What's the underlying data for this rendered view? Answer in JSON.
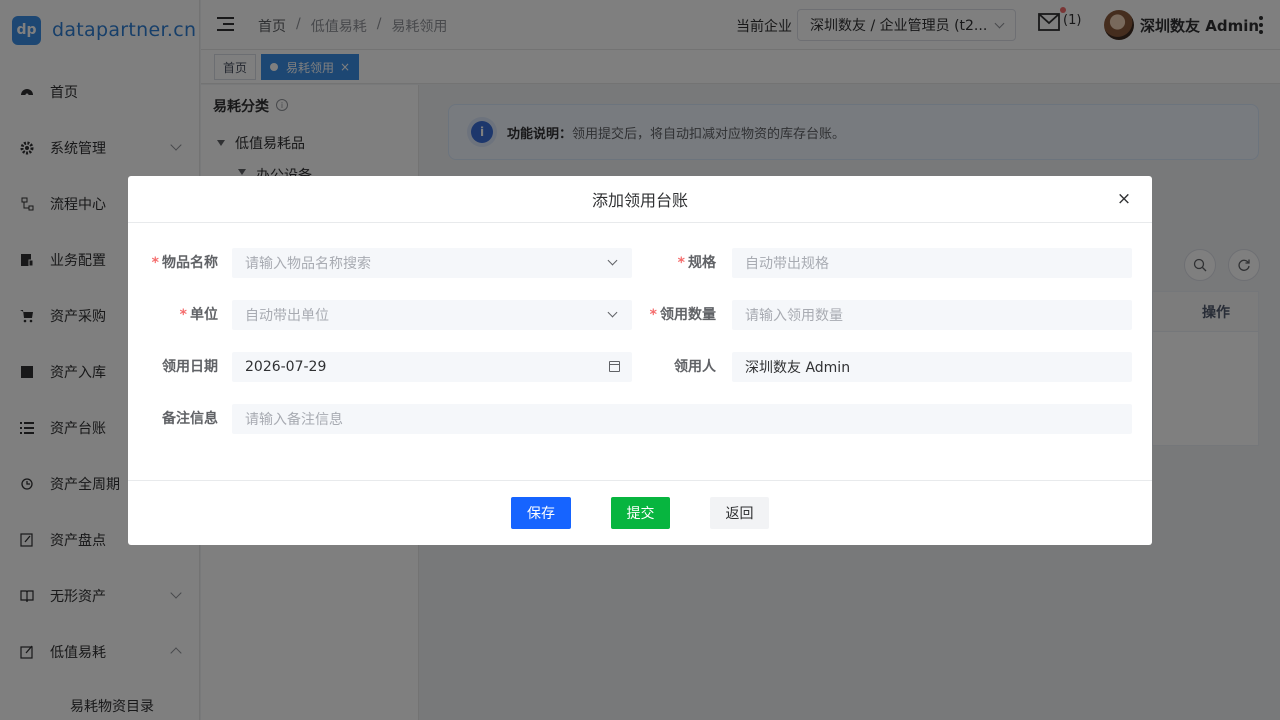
{
  "brand": {
    "badge": "dp",
    "name": "datapartner.cn"
  },
  "sidebar": {
    "items": [
      {
        "label": "首页",
        "icon": "dashboard-icon"
      },
      {
        "label": "系统管理",
        "icon": "gear-icon"
      },
      {
        "label": "流程中心",
        "icon": "flow-icon"
      },
      {
        "label": "业务配置",
        "icon": "config-icon"
      },
      {
        "label": "资产采购",
        "icon": "cart-icon"
      },
      {
        "label": "资产入库",
        "icon": "warehouse-icon"
      },
      {
        "label": "资产台账",
        "icon": "list-icon"
      },
      {
        "label": "资产全周期",
        "icon": "cycle-icon"
      },
      {
        "label": "资产盘点",
        "icon": "edit-icon"
      },
      {
        "label": "无形资产",
        "icon": "book-icon"
      },
      {
        "label": "低值易耗",
        "icon": "note-icon"
      }
    ],
    "sub_item": "易耗物资目录"
  },
  "header": {
    "breadcrumb": [
      "首页",
      "低值易耗",
      "易耗领用"
    ],
    "company_label": "当前企业",
    "company_value": "深圳数友 / 企业管理员 (t2...",
    "mail_count": "(1)",
    "user_name": "深圳数友 Admin"
  },
  "tags": {
    "home": "首页",
    "active": "易耗领用"
  },
  "tree": {
    "title": "易耗分类",
    "root": "低值易耗品",
    "child": "办公设备"
  },
  "notice": {
    "label": "功能说明：",
    "text": "领用提交后，将自动扣减对应物资的库存台账。"
  },
  "table": {
    "op_header": "操作"
  },
  "dialog": {
    "title": "添加领用台账",
    "close": "×",
    "fields": {
      "item_name": {
        "label": "物品名称",
        "placeholder": "请输入物品名称搜索"
      },
      "spec": {
        "label": "规格",
        "placeholder": "自动带出规格"
      },
      "unit": {
        "label": "单位",
        "placeholder": "自动带出单位"
      },
      "qty": {
        "label": "领用数量",
        "placeholder": "请输入领用数量"
      },
      "date": {
        "label": "领用日期",
        "value": "2026-07-29"
      },
      "person": {
        "label": "领用人",
        "value": "深圳数友 Admin"
      },
      "remark": {
        "label": "备注信息",
        "placeholder": "请输入备注信息"
      }
    },
    "buttons": {
      "save": "保存",
      "submit": "提交",
      "back": "返回"
    }
  },
  "colors": {
    "primary": "#1664ff",
    "success": "#07b53f",
    "tag_active": "#3a8ee6",
    "required": "#f56c6c"
  }
}
